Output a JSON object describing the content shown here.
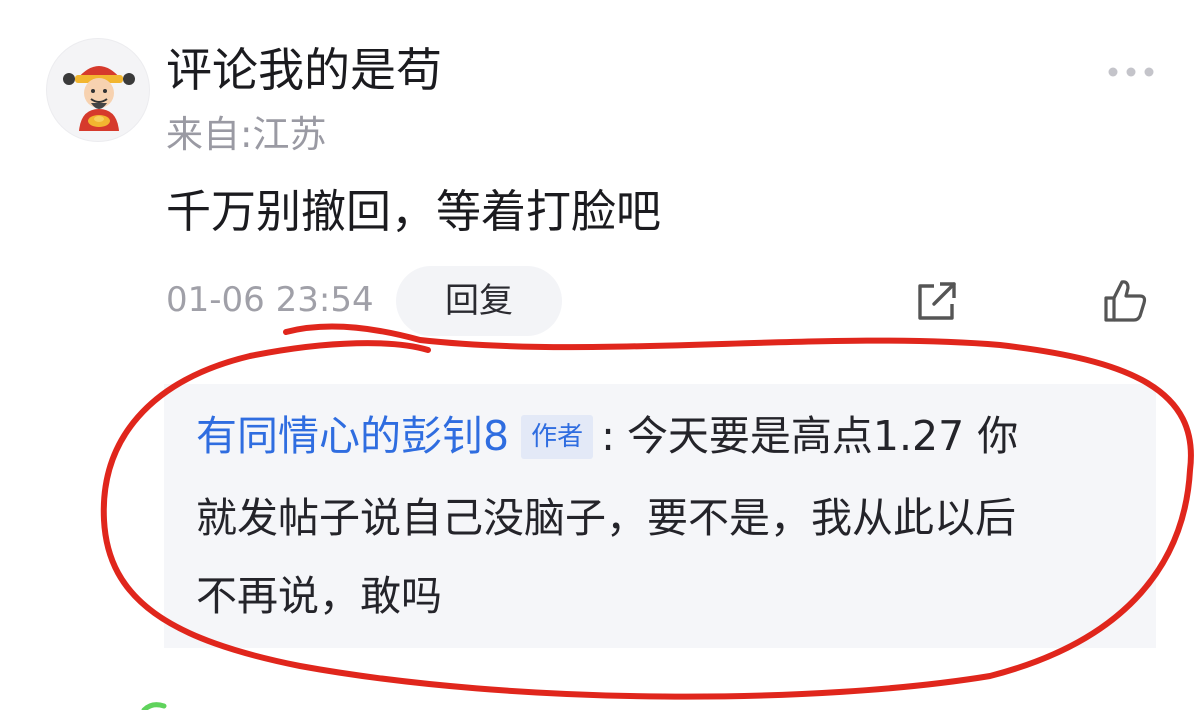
{
  "comment": {
    "username": "评论我的是苟",
    "location": "来自:江苏",
    "text": "千万别撤回，等着打脸吧",
    "timestamp": "01-06 23:54",
    "reply_label": "回复"
  },
  "reply": {
    "author": "有同情心的彭钊8",
    "badge": "作者",
    "separator": ":",
    "line1": "今天要是高点1.27 你",
    "line2": "就发帖子说自己没脑子，要不是，我从此以后",
    "line3": "不再说，敢吗"
  },
  "icons": {
    "avatar": "caishen-avatar",
    "more": "more-dots-icon",
    "share": "share-icon",
    "like": "thumbs-up-icon"
  },
  "colors": {
    "link": "#2f6de0",
    "annotation": "#e0261c",
    "reply_bg": "#f5f6f9"
  }
}
